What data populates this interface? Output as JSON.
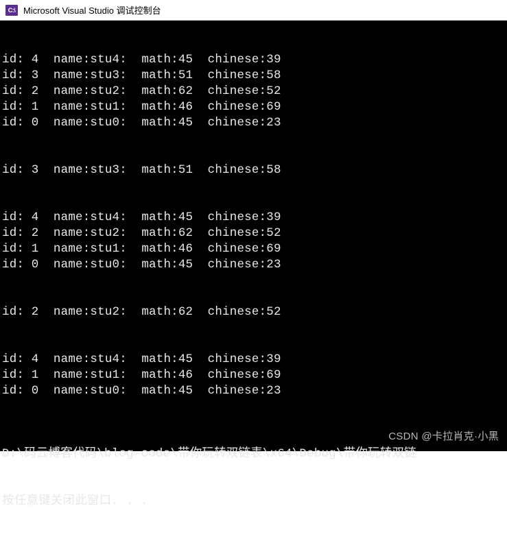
{
  "window": {
    "icon_label": "C:\\",
    "title": "Microsoft Visual Studio 调试控制台"
  },
  "blocks": [
    {
      "rows": [
        {
          "id": 4,
          "name": "stu4",
          "math": 45,
          "chinese": 39
        },
        {
          "id": 3,
          "name": "stu3",
          "math": 51,
          "chinese": 58
        },
        {
          "id": 2,
          "name": "stu2",
          "math": 62,
          "chinese": 52
        },
        {
          "id": 1,
          "name": "stu1",
          "math": 46,
          "chinese": 69
        },
        {
          "id": 0,
          "name": "stu0",
          "math": 45,
          "chinese": 23
        }
      ]
    },
    {
      "rows": [
        {
          "id": 3,
          "name": "stu3",
          "math": 51,
          "chinese": 58
        }
      ]
    },
    {
      "rows": [
        {
          "id": 4,
          "name": "stu4",
          "math": 45,
          "chinese": 39
        },
        {
          "id": 2,
          "name": "stu2",
          "math": 62,
          "chinese": 52
        },
        {
          "id": 1,
          "name": "stu1",
          "math": 46,
          "chinese": 69
        },
        {
          "id": 0,
          "name": "stu0",
          "math": 45,
          "chinese": 23
        }
      ]
    },
    {
      "rows": [
        {
          "id": 2,
          "name": "stu2",
          "math": 62,
          "chinese": 52
        }
      ]
    },
    {
      "rows": [
        {
          "id": 4,
          "name": "stu4",
          "math": 45,
          "chinese": 39
        },
        {
          "id": 1,
          "name": "stu1",
          "math": 46,
          "chinese": 69
        },
        {
          "id": 0,
          "name": "stu0",
          "math": 45,
          "chinese": 23
        }
      ]
    }
  ],
  "footer": {
    "path_line": "D:\\码云博客代码\\blog-code\\带你玩转双链表\\x64\\Debug\\带你玩转双链",
    "prompt_line": "按任意键关闭此窗口. . ."
  },
  "watermark": "CSDN @卡拉肖克·小黑",
  "labels": {
    "id": "id:",
    "name": "name:",
    "math": "math:",
    "chinese": "chinese:"
  }
}
